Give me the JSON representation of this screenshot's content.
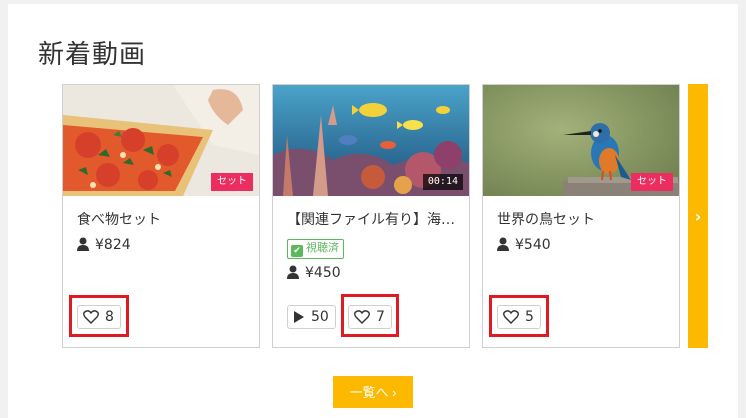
{
  "section": {
    "title": "新着動画"
  },
  "cards": [
    {
      "title": "食べ物セット",
      "price": "¥824",
      "badge": "セット",
      "likes": "8"
    },
    {
      "title": "【関連ファイル有り】海…",
      "watched_label": "視聴済",
      "price": "¥450",
      "duration": "00:14",
      "plays": "50",
      "likes": "7"
    },
    {
      "title": "世界の鳥セット",
      "price": "¥540",
      "badge": "セット",
      "likes": "5"
    }
  ],
  "carousel": {
    "next_glyph": "›"
  },
  "list_button": {
    "label": "一覧へ ›"
  },
  "colors": {
    "accent": "#fcb900",
    "badge": "#ec2d5f",
    "watched": "#5cb85c",
    "highlight": "#e01a22"
  },
  "icons": {
    "user": "user-icon",
    "heart": "heart-icon",
    "play": "play-icon",
    "check": "check-icon",
    "chevron": "chevron-right-icon"
  }
}
